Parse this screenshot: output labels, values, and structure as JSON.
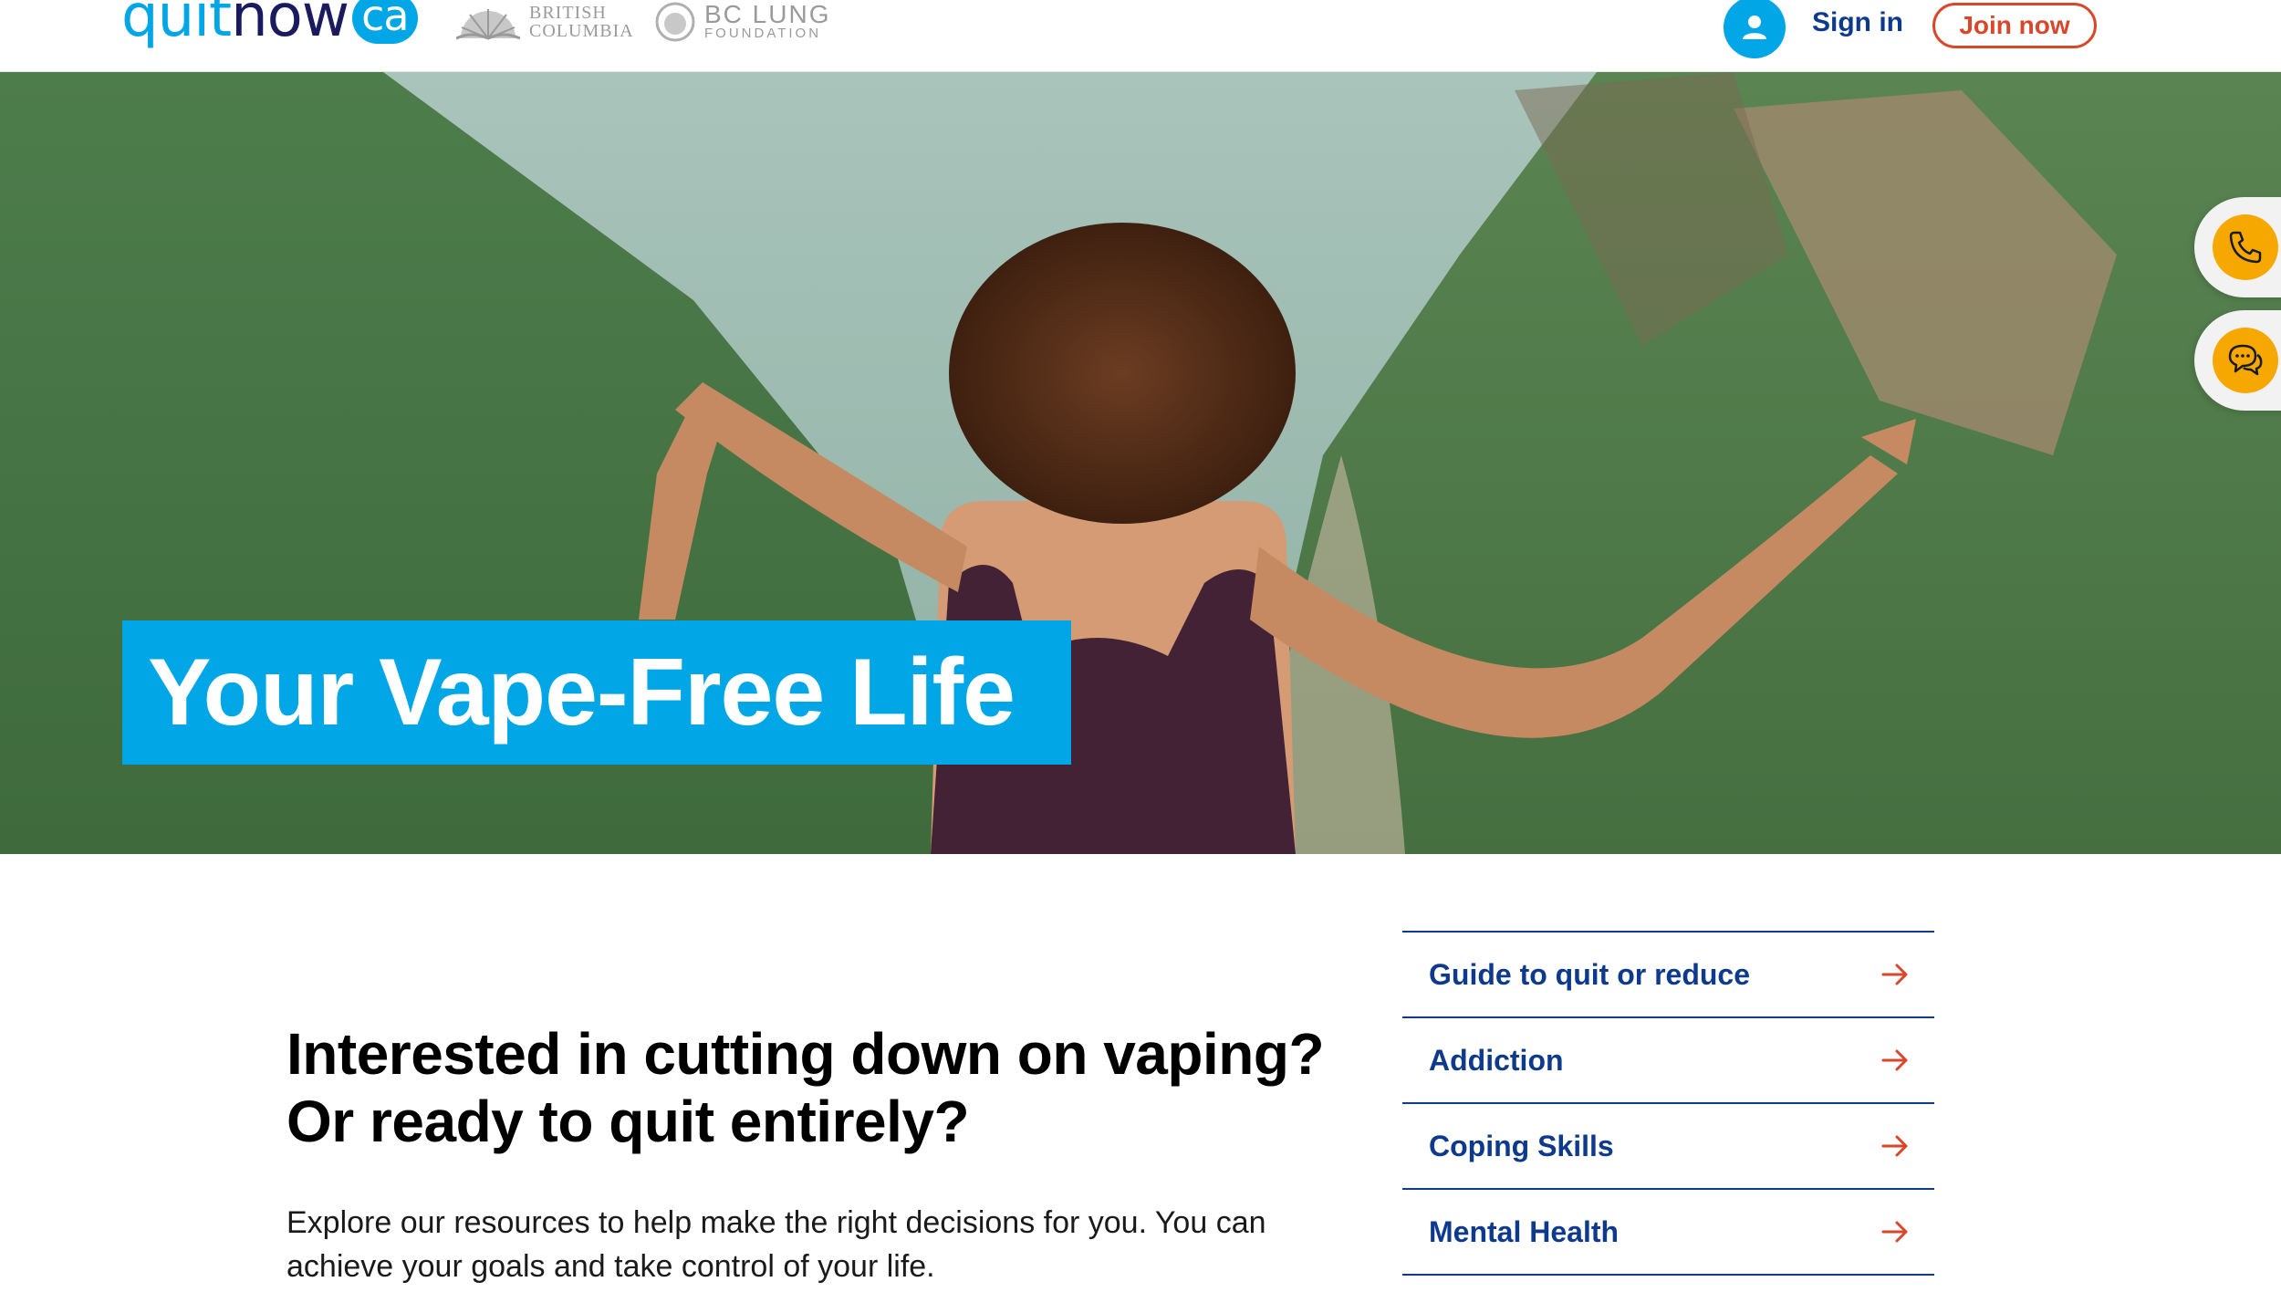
{
  "header": {
    "logo": {
      "quit": "quit",
      "now": "now",
      "ca": "ca"
    },
    "partners": {
      "bc_line1": "BRITISH",
      "bc_line2": "COLUMBIA",
      "lung_line1": "BC LUNG",
      "lung_line2": "FOUNDATION"
    },
    "sign_in": "Sign in",
    "join_now": "Join now"
  },
  "hero": {
    "title": "Your Vape-Free Life"
  },
  "side_buttons": {
    "phone_icon": "phone-icon",
    "chat_icon": "chat-icon"
  },
  "main": {
    "heading": "Interested in cutting down on vaping? Or ready to quit entirely?",
    "body": "Explore our resources to help make the right decisions for you.  You can achieve your goals and take control of your life.",
    "links": [
      {
        "label": "Guide to quit or reduce"
      },
      {
        "label": "Addiction"
      },
      {
        "label": "Coping Skills"
      },
      {
        "label": "Mental Health"
      }
    ]
  },
  "colors": {
    "brand_blue": "#00a6e6",
    "navy": "#0d3a8c",
    "accent_red": "#d9472b",
    "accent_orange": "#f6a800"
  }
}
